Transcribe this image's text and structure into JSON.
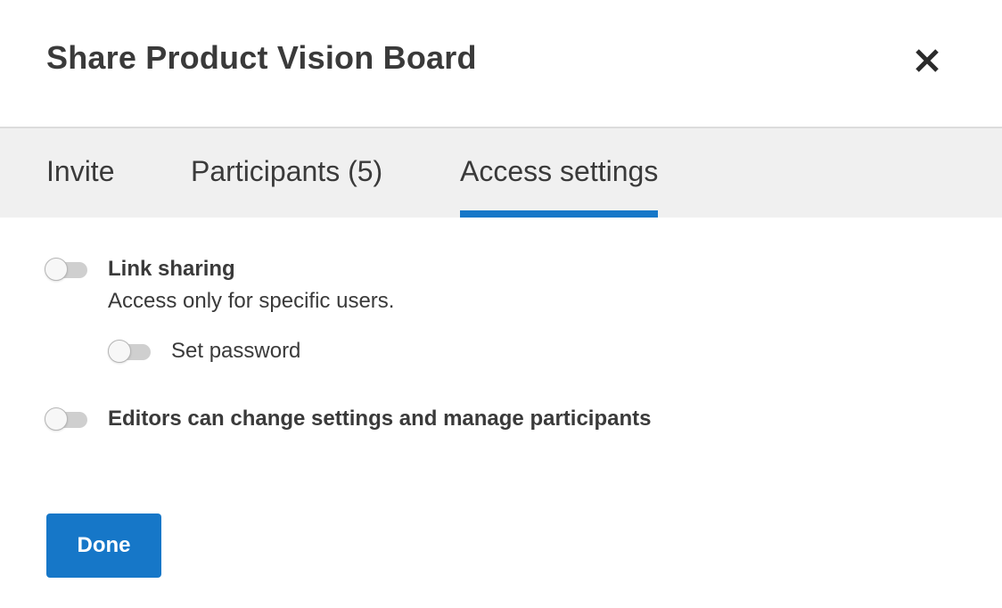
{
  "dialog": {
    "title": "Share Product Vision Board",
    "close_icon": "close-icon"
  },
  "tabs": [
    {
      "label": "Invite",
      "active": false
    },
    {
      "label": "Participants (5)",
      "active": false
    },
    {
      "label": "Access settings",
      "active": true
    }
  ],
  "settings": {
    "link_sharing": {
      "label": "Link sharing",
      "description": "Access only for specific users.",
      "enabled": false
    },
    "set_password": {
      "label": "Set password",
      "enabled": false
    },
    "editors_manage": {
      "label": "Editors can change settings and manage participants",
      "enabled": false
    }
  },
  "footer": {
    "done_label": "Done"
  },
  "colors": {
    "accent": "#1677c8",
    "tab_bar_bg": "#f0f0f0",
    "toggle_off_track": "#cfcfcf"
  }
}
